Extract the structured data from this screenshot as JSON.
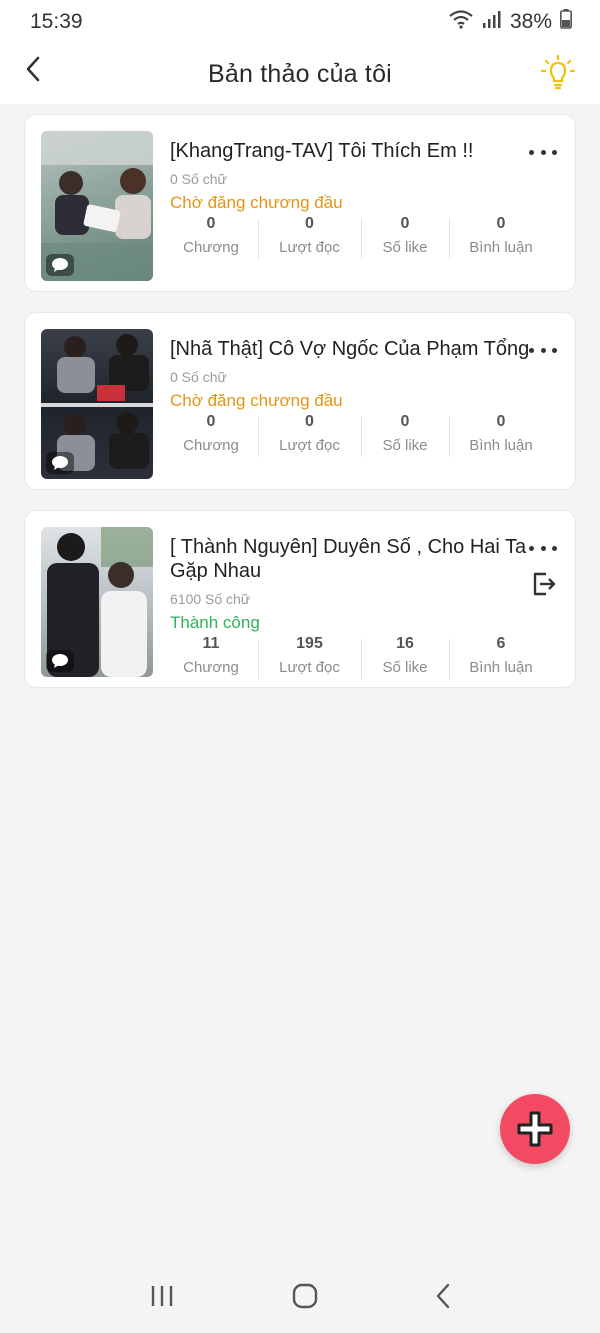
{
  "status_bar": {
    "time": "15:39",
    "battery": "38%"
  },
  "header": {
    "title": "Bản thảo của tôi"
  },
  "drafts": [
    {
      "title": "[KhangTrang-TAV] Tôi Thích Em !!",
      "word_count": "0 Số chữ",
      "status": "Chờ đăng chương đầu",
      "stats": [
        {
          "value": "0",
          "label": "Chương"
        },
        {
          "value": "0",
          "label": "Lượt đọc"
        },
        {
          "value": "0",
          "label": "Số like"
        },
        {
          "value": "0",
          "label": "Bình luận"
        }
      ]
    },
    {
      "title": "[Nhã Thật] Cô Vợ Ngốc Của Phạm Tổng",
      "word_count": "0 Số chữ",
      "status": "Chờ đăng chương đầu",
      "stats": [
        {
          "value": "0",
          "label": "Chương"
        },
        {
          "value": "0",
          "label": "Lượt đọc"
        },
        {
          "value": "0",
          "label": "Số like"
        },
        {
          "value": "0",
          "label": "Bình luận"
        }
      ]
    },
    {
      "title": "[ Thành Nguyên] Duyên Số , Cho Hai Ta Gặp Nhau",
      "word_count": "6100 Số chữ",
      "status": "Thành công",
      "stats": [
        {
          "value": "11",
          "label": "Chương"
        },
        {
          "value": "195",
          "label": "Lượt đọc"
        },
        {
          "value": "16",
          "label": "Số like"
        },
        {
          "value": "6",
          "label": "Bình luận"
        }
      ]
    }
  ],
  "colors": {
    "pending": "#e69414",
    "success": "#2fb25a",
    "fab": "#f24a63",
    "tip": "#f2c200"
  }
}
